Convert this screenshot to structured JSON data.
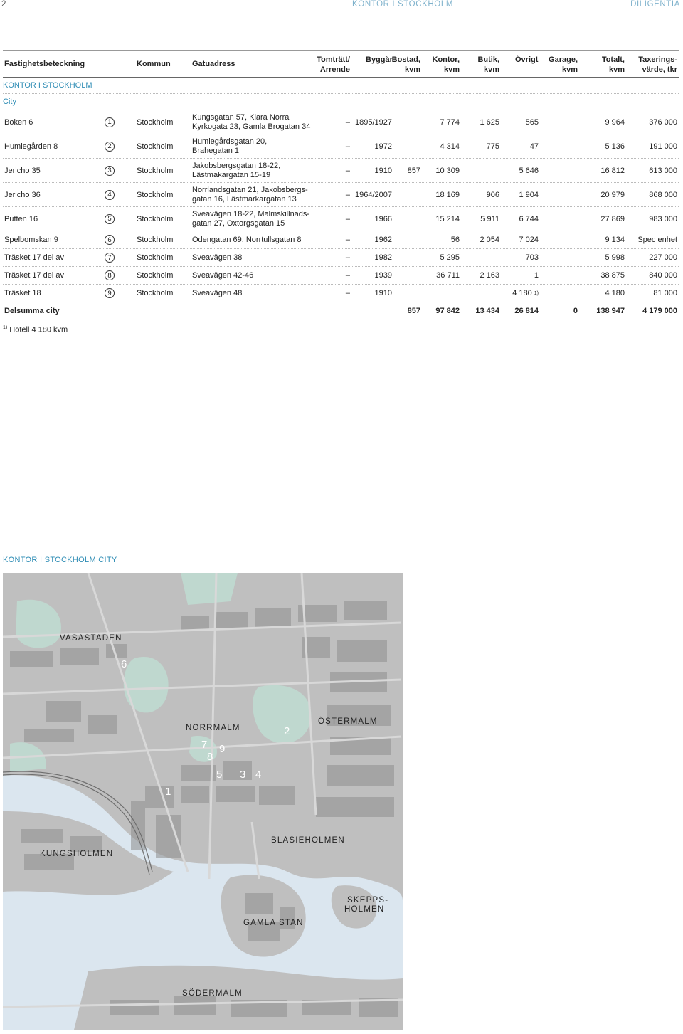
{
  "header": {
    "page_number": "2",
    "section": "KONTOR I STOCKHOLM",
    "brand": "DILIGENTIA"
  },
  "table": {
    "columns": {
      "fastighet": "Fastighetsbeteckning",
      "kommun": "Kommun",
      "gatuadress": "Gatuadress",
      "tomtratt_1": "Tomträtt/",
      "tomtratt_2": "Arrende",
      "byggar": "Byggår",
      "bostad_1": "Bostad,",
      "bostad_2": "kvm",
      "kontor_1": "Kontor,",
      "kontor_2": "kvm",
      "butik_1": "Butik,",
      "butik_2": "kvm",
      "ovrigt": "Övrigt",
      "garage_1": "Garage,",
      "garage_2": "kvm",
      "totalt_1": "Totalt,",
      "totalt_2": "kvm",
      "tax_1": "Taxerings-",
      "tax_2": "värde, tkr"
    },
    "group_title": "KONTOR I STOCKHOLM",
    "subgroup_title": "City",
    "rows": [
      {
        "name": "Boken 6",
        "marker": "1",
        "kommun": "Stockholm",
        "addr1": "Kungsgatan 57, Klara Norra",
        "addr2": "Kyrkogata 23, Gamla Brogatan 34",
        "tomtratt": "–",
        "byggar": "1895/1927",
        "bostad": "",
        "kontor": "7 774",
        "butik": "1 625",
        "ovrigt": "565",
        "garage": "",
        "totalt": "9 964",
        "tax": "376 000"
      },
      {
        "name": "Humlegården 8",
        "marker": "2",
        "kommun": "Stockholm",
        "addr1": "Humlegårdsgatan 20,",
        "addr2": "Brahegatan 1",
        "tomtratt": "–",
        "byggar": "1972",
        "bostad": "",
        "kontor": "4 314",
        "butik": "775",
        "ovrigt": "47",
        "garage": "",
        "totalt": "5 136",
        "tax": "191 000"
      },
      {
        "name": "Jericho 35",
        "marker": "3",
        "kommun": "Stockholm",
        "addr1": "Jakobsbergsgatan 18-22,",
        "addr2": "Lästmakargatan 15-19",
        "tomtratt": "–",
        "byggar": "1910",
        "bostad": "857",
        "kontor": "10 309",
        "butik": "",
        "ovrigt": "5 646",
        "garage": "",
        "totalt": "16 812",
        "tax": "613 000"
      },
      {
        "name": "Jericho 36",
        "marker": "4",
        "kommun": "Stockholm",
        "addr1": "Norrlandsgatan 21, Jakobsbergs-",
        "addr2": "gatan 16, Lästmarkargatan 13",
        "tomtratt": "–",
        "byggar": "1964/2007",
        "bostad": "",
        "kontor": "18 169",
        "butik": "906",
        "ovrigt": "1 904",
        "garage": "",
        "totalt": "20 979",
        "tax": "868 000"
      },
      {
        "name": "Putten 16",
        "marker": "5",
        "kommun": "Stockholm",
        "addr1": "Sveavägen 18-22, Malmskillnads-",
        "addr2": "gatan 27, Oxtorgsgatan 15",
        "tomtratt": "–",
        "byggar": "1966",
        "bostad": "",
        "kontor": "15 214",
        "butik": "5 911",
        "ovrigt": "6 744",
        "garage": "",
        "totalt": "27 869",
        "tax": "983 000"
      },
      {
        "name": "Spelbomskan 9",
        "marker": "6",
        "kommun": "Stockholm",
        "addr1": "Odengatan 69, Norrtullsgatan 8",
        "addr2": "",
        "tomtratt": "–",
        "byggar": "1962",
        "bostad": "",
        "kontor": "56",
        "butik": "2 054",
        "ovrigt": "7 024",
        "garage": "",
        "totalt": "9 134",
        "tax": "Spec enhet"
      },
      {
        "name": "Träsket 17 del av",
        "marker": "7",
        "kommun": "Stockholm",
        "addr1": "Sveavägen 38",
        "addr2": "",
        "tomtratt": "–",
        "byggar": "1982",
        "bostad": "",
        "kontor": "5 295",
        "butik": "",
        "ovrigt": "703",
        "garage": "",
        "totalt": "5 998",
        "tax": "227 000"
      },
      {
        "name": "Träsket 17 del av",
        "marker": "8",
        "kommun": "Stockholm",
        "addr1": "Sveavägen 42-46",
        "addr2": "",
        "tomtratt": "–",
        "byggar": "1939",
        "bostad": "",
        "kontor": "36 711",
        "butik": "2 163",
        "ovrigt": "1",
        "garage": "",
        "totalt": "38 875",
        "tax": "840 000"
      },
      {
        "name": "Träsket 18",
        "marker": "9",
        "kommun": "Stockholm",
        "addr1": "Sveavägen 48",
        "addr2": "",
        "tomtratt": "–",
        "byggar": "1910",
        "bostad": "",
        "kontor": "",
        "butik": "",
        "ovrigt": "4 180",
        "ovrigt_note": "1)",
        "garage": "",
        "totalt": "4 180",
        "tax": "81 000"
      }
    ],
    "subtotal": {
      "label": "Delsumma city",
      "bostad": "857",
      "kontor": "97 842",
      "butik": "13 434",
      "ovrigt": "26 814",
      "garage": "0",
      "totalt": "138 947",
      "tax": "4 179 000"
    },
    "footnote": {
      "mark": "1)",
      "text": "Hotell 4 180 kvm"
    }
  },
  "map": {
    "title": "KONTOR I STOCKHOLM CITY",
    "areas": {
      "vasastaden": "VASASTADEN",
      "norrmalm": "NORRMALM",
      "ostermalm": "ÖSTERMALM",
      "kungsholmen": "KUNGSHOLMEN",
      "blasieholmen": "BLASIEHOLMEN",
      "skeppsholmen_1": "SKEPPS-",
      "skeppsholmen_2": "HOLMEN",
      "gamla_stan": "GAMLA STAN",
      "sodermalm": "SÖDERMALM"
    },
    "markers": [
      "1",
      "2",
      "3",
      "4",
      "5",
      "6",
      "7",
      "8",
      "9"
    ],
    "colors": {
      "land": "#bfbfbf",
      "block": "#8e8e8e",
      "park": "#bfd8cf",
      "water": "#dbe6ef",
      "accent": "#2f8db5"
    }
  }
}
